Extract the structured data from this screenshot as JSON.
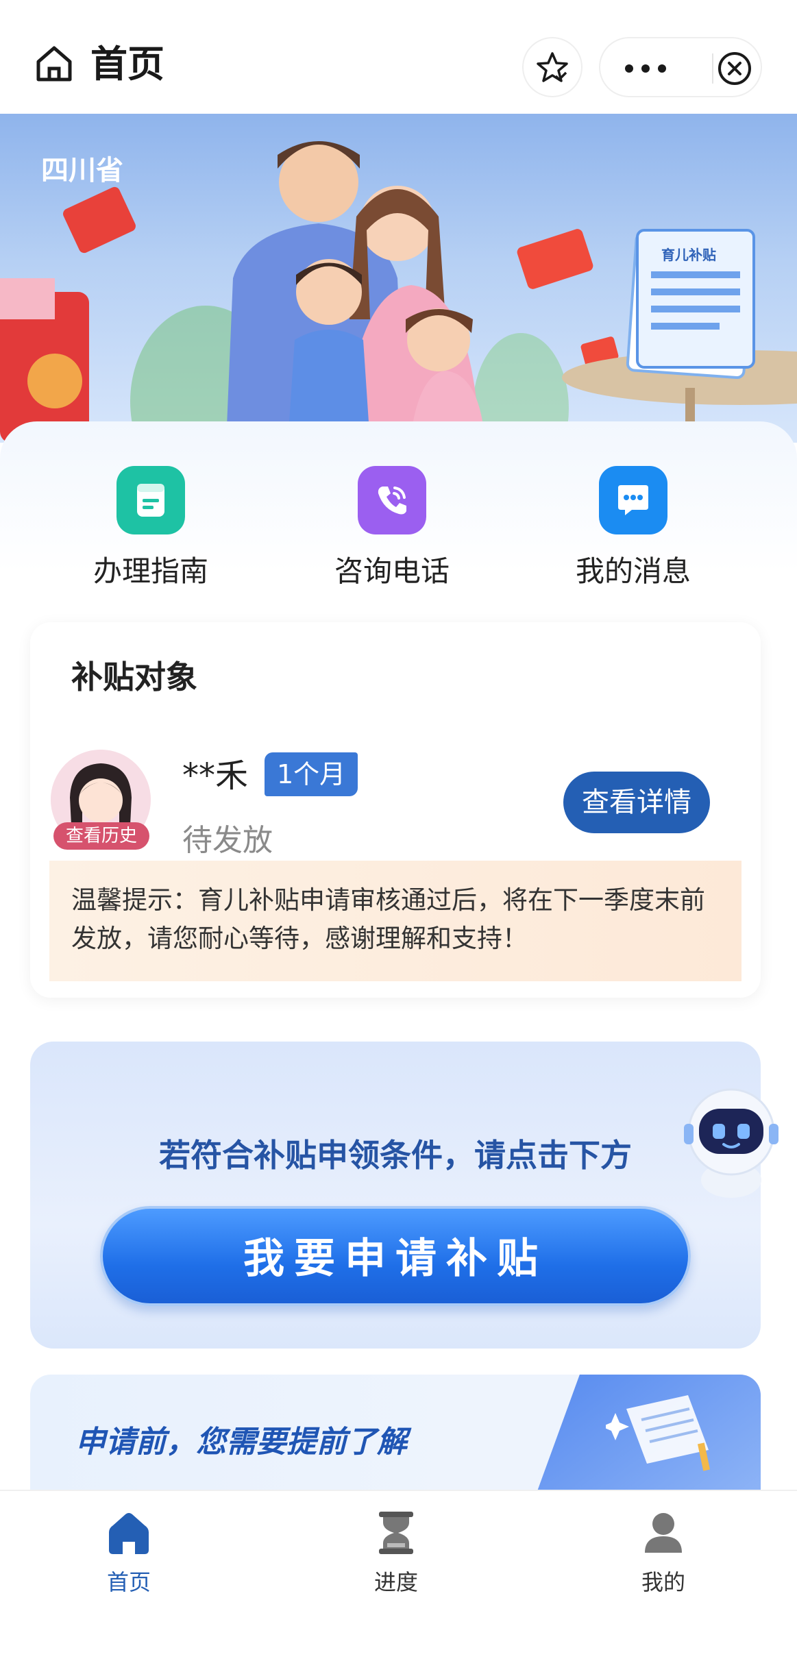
{
  "header": {
    "title": "首页"
  },
  "hero": {
    "province": "四川省",
    "doc_label": "育儿补贴"
  },
  "quick_actions": [
    {
      "label": "办理指南",
      "icon": "guide-icon",
      "color": "#1ec2a4"
    },
    {
      "label": "咨询电话",
      "icon": "phone-icon",
      "color": "#9b5ff0"
    },
    {
      "label": "我的消息",
      "icon": "message-icon",
      "color": "#1b8cf2"
    }
  ],
  "subsidy": {
    "title": "补贴对象",
    "avatar_badge": "查看历史",
    "child_name": "**禾",
    "age": "1个月",
    "status": "待发放",
    "detail_button": "查看详情",
    "notice": "温馨提示：育儿补贴申请审核通过后，将在下一季度末前发放，请您耐心等待，感谢理解和支持！"
  },
  "apply": {
    "prompt": "若符合补贴申领条件，请点击下方",
    "button": "我要申请补贴"
  },
  "pre_apply": {
    "title": "申请前，您需要提前了解"
  },
  "tabbar": {
    "items": [
      {
        "label": "首页",
        "icon": "home-icon",
        "active": true
      },
      {
        "label": "进度",
        "icon": "hourglass-icon",
        "active": false
      },
      {
        "label": "我的",
        "icon": "user-icon",
        "active": false
      }
    ]
  },
  "colors": {
    "primary": "#245fb4",
    "apply_button": "#1f6fe8",
    "tab_active": "#245fb4",
    "tab_inactive": "#333333"
  }
}
